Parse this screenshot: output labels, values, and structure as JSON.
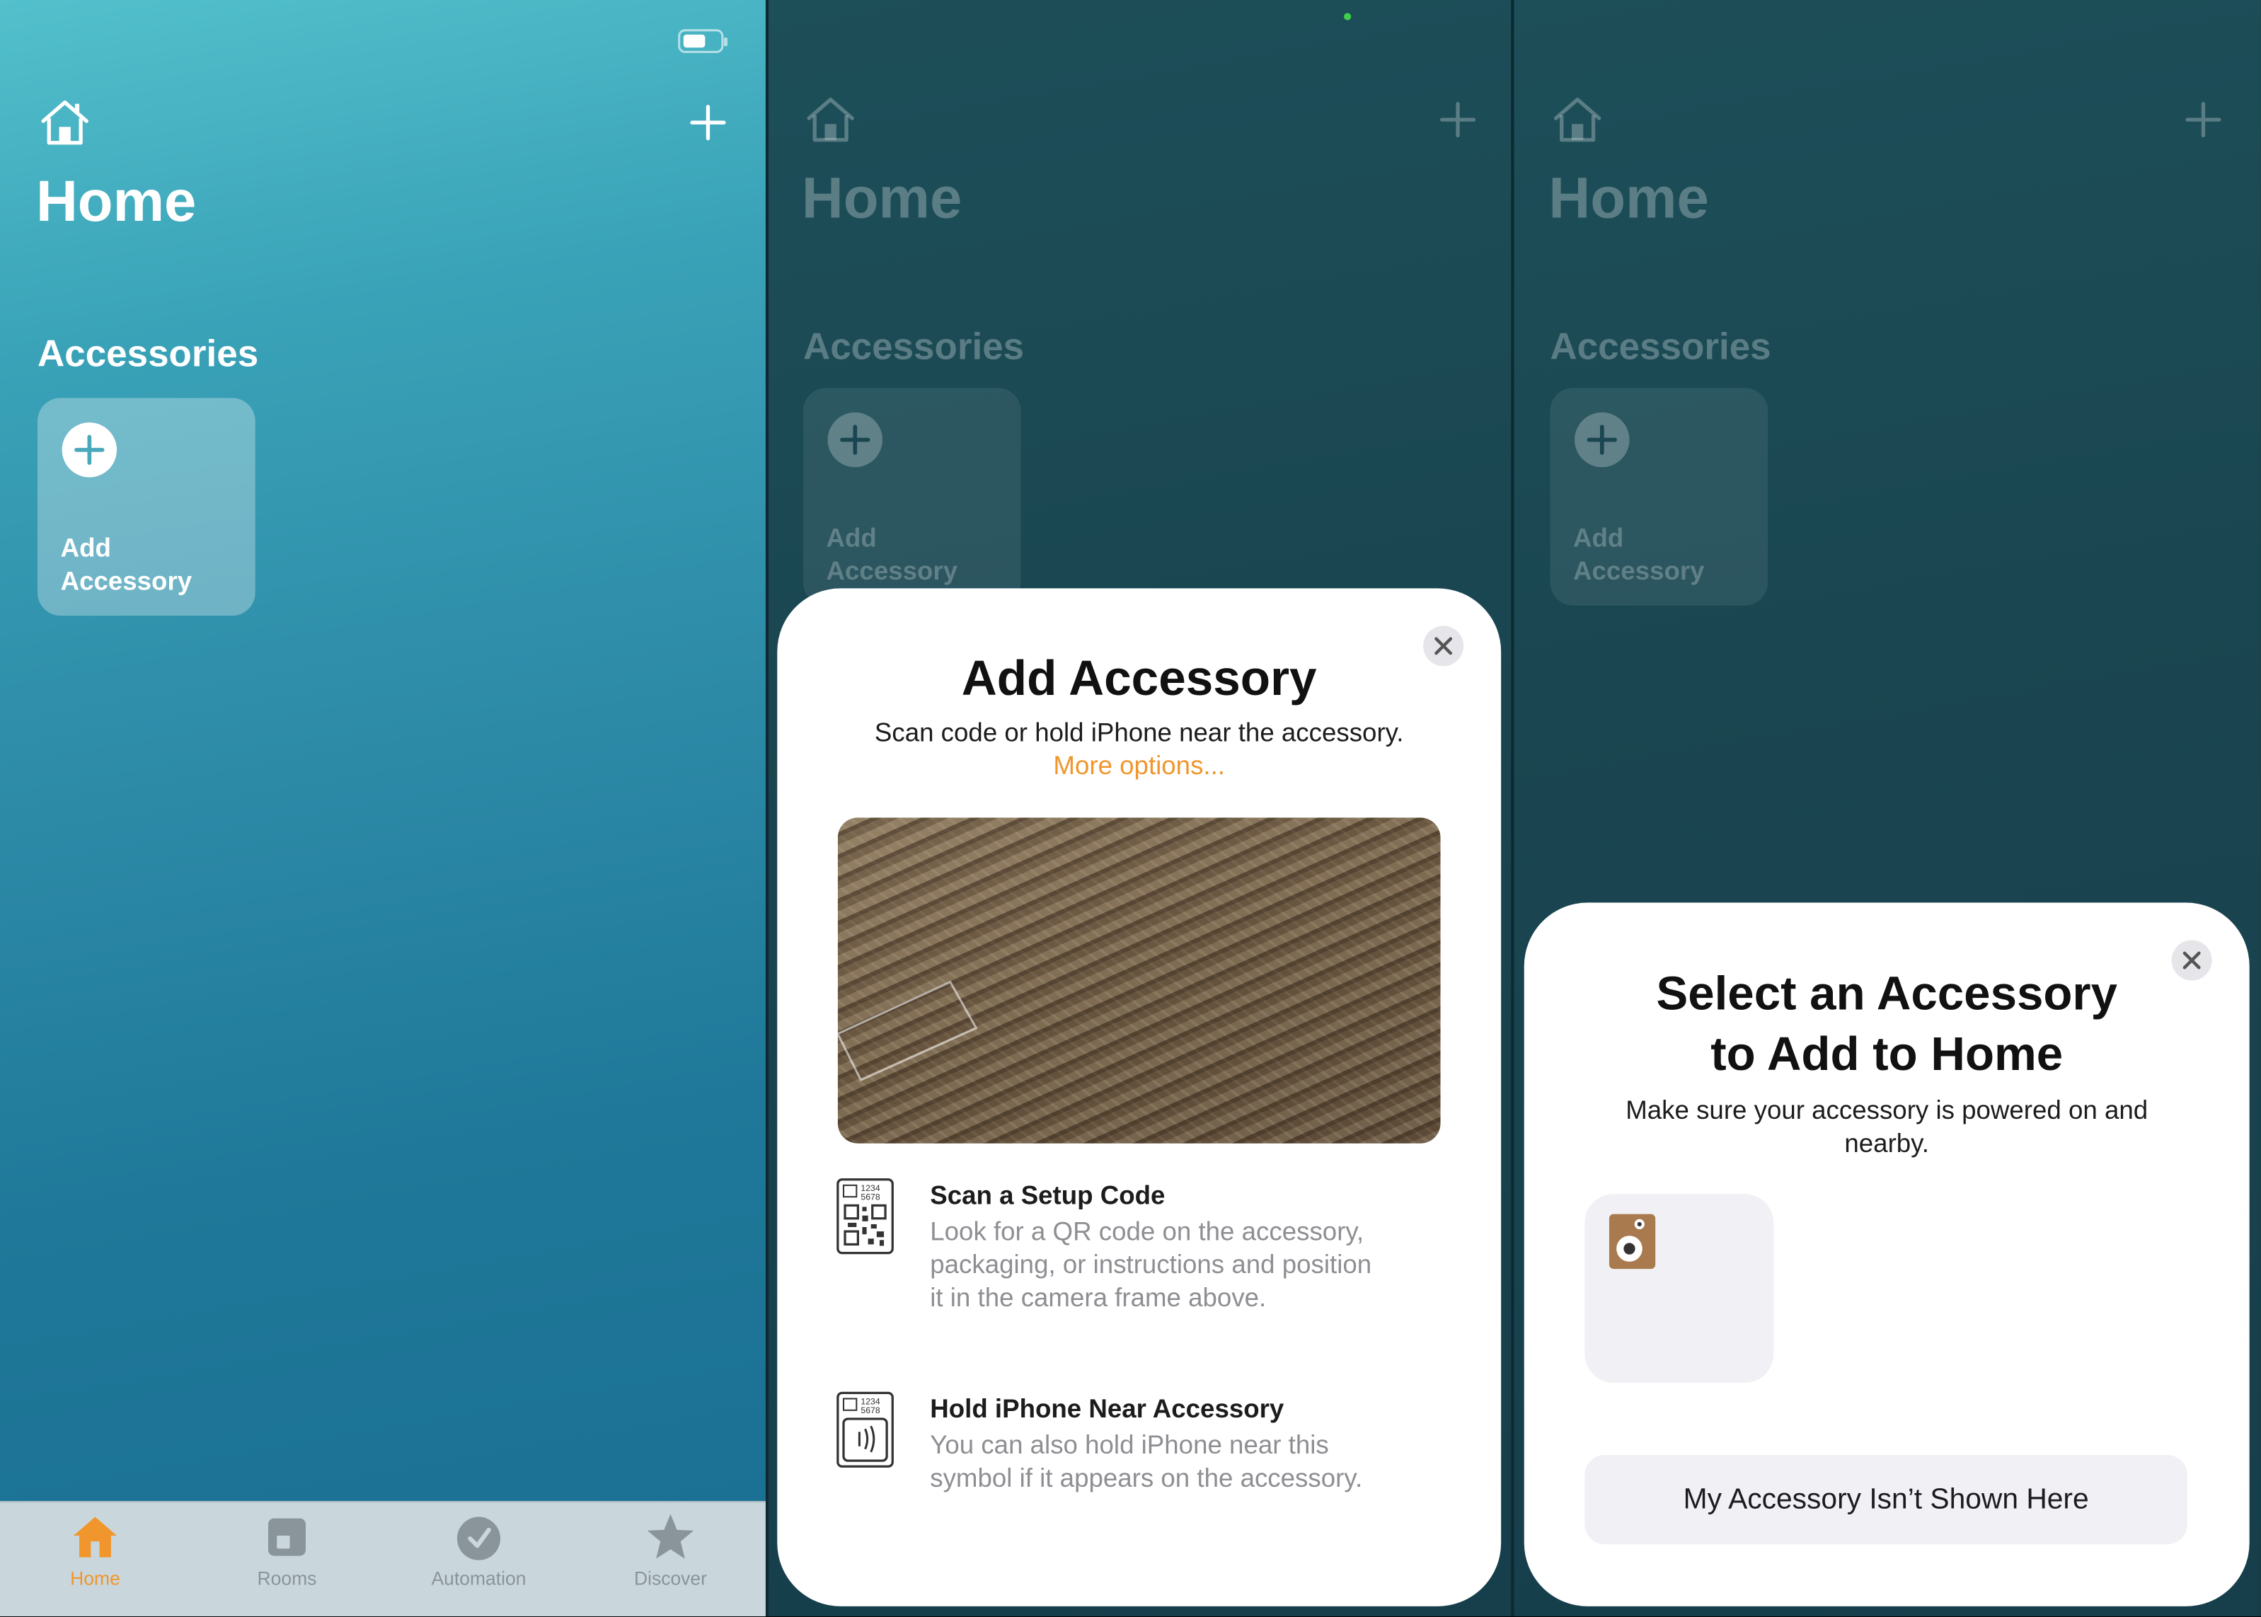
{
  "screen1": {
    "title": "Home",
    "section_title": "Accessories",
    "add_tile_label": "Add Accessory",
    "tabs": [
      {
        "label": "Home",
        "icon": "house-fill-icon",
        "active": true
      },
      {
        "label": "Rooms",
        "icon": "rooms-icon",
        "active": false
      },
      {
        "label": "Automation",
        "icon": "clock-check-icon",
        "active": false
      },
      {
        "label": "Discover",
        "icon": "star-icon",
        "active": false
      }
    ]
  },
  "screen2": {
    "title": "Home",
    "section_title": "Accessories",
    "add_tile_label": "Add Accessory",
    "sheet": {
      "title": "Add Accessory",
      "subtitle": "Scan code or hold iPhone near the accessory.",
      "more_options": "More options...",
      "options": [
        {
          "title": "Scan a Setup Code",
          "description": "Look for a QR code on the accessory, packaging, or instructions and position it in the camera frame above.",
          "icon": "qr-setup-code-icon"
        },
        {
          "title": "Hold iPhone Near Accessory",
          "description": "You can also hold iPhone near this symbol if it appears on the accessory.",
          "icon": "nfc-tag-icon"
        }
      ]
    }
  },
  "screen3": {
    "title": "Home",
    "section_title": "Accessories",
    "add_tile_label": "Add Accessory",
    "sheet": {
      "title_line1": "Select an Accessory",
      "title_line2": "to Add to Home",
      "subtitle": "Make sure your accessory is powered on and nearby.",
      "button_label": "My Accessory Isn’t Shown Here",
      "accessory_icon": "speaker-icon"
    }
  },
  "colors": {
    "accent_orange": "#f0962c",
    "sheet_background": "#ffffff",
    "secondary_text": "#8e8e93"
  }
}
